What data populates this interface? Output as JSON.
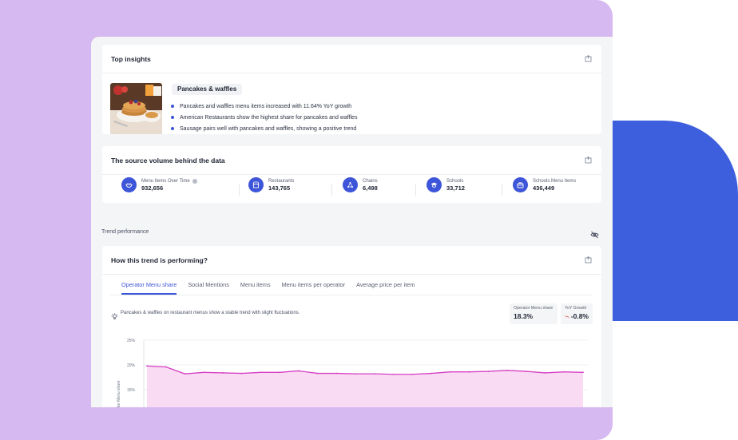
{
  "insights": {
    "title": "Top insights",
    "topic": "Pancakes & waffles",
    "bullets": [
      "Pancakes and waffles menu items increased with 11.64% YoY growth",
      "American Restaurants show the highest share for pancakes and waffles",
      "Sausage pairs well with pancakes and waffles, showing a positive trend"
    ]
  },
  "source": {
    "title": "The source volume behind the data",
    "stats": [
      {
        "label": "Menu Items Over Time",
        "value": "932,656",
        "icon": "bowl-icon"
      },
      {
        "label": "Restaurants",
        "value": "143,765",
        "icon": "storefront-icon"
      },
      {
        "label": "Chains",
        "value": "6,498",
        "icon": "network-icon"
      },
      {
        "label": "Schools",
        "value": "33,712",
        "icon": "graduation-cap-icon"
      },
      {
        "label": "Schools Menu Items",
        "value": "436,449",
        "icon": "lunchbox-icon"
      }
    ]
  },
  "section": {
    "label": "Trend performance"
  },
  "trend": {
    "title": "How this trend is performing?",
    "tabs": [
      "Operator Menu share",
      "Social Mentions",
      "Menu items",
      "Menu items per operator",
      "Average price per item"
    ],
    "active_tab": 0,
    "summary": "Pancakes & waffles on restaurant menus show a stable trend with slight fluctuations.",
    "metrics": [
      {
        "label": "Operator Menu share",
        "value": "18.3%"
      },
      {
        "label": "YoY Growth",
        "value": "-0.8%"
      }
    ]
  },
  "colors": {
    "accent": "#3d55d8",
    "line": "#d63fc4",
    "fill": "#f9dcf3"
  },
  "chart_data": {
    "type": "area",
    "ylabel": "Operator Menu share",
    "y_ticks": [
      "25%",
      "20%",
      "15%"
    ],
    "ylim": [
      12.5,
      25
    ],
    "values": [
      19.8,
      19.6,
      18.2,
      18.5,
      18.4,
      18.3,
      18.5,
      18.5,
      18.8,
      18.3,
      18.3,
      18.2,
      18.2,
      18.1,
      18.1,
      18.3,
      18.6,
      18.6,
      18.7,
      18.9,
      18.7,
      18.4,
      18.6,
      18.5
    ]
  }
}
